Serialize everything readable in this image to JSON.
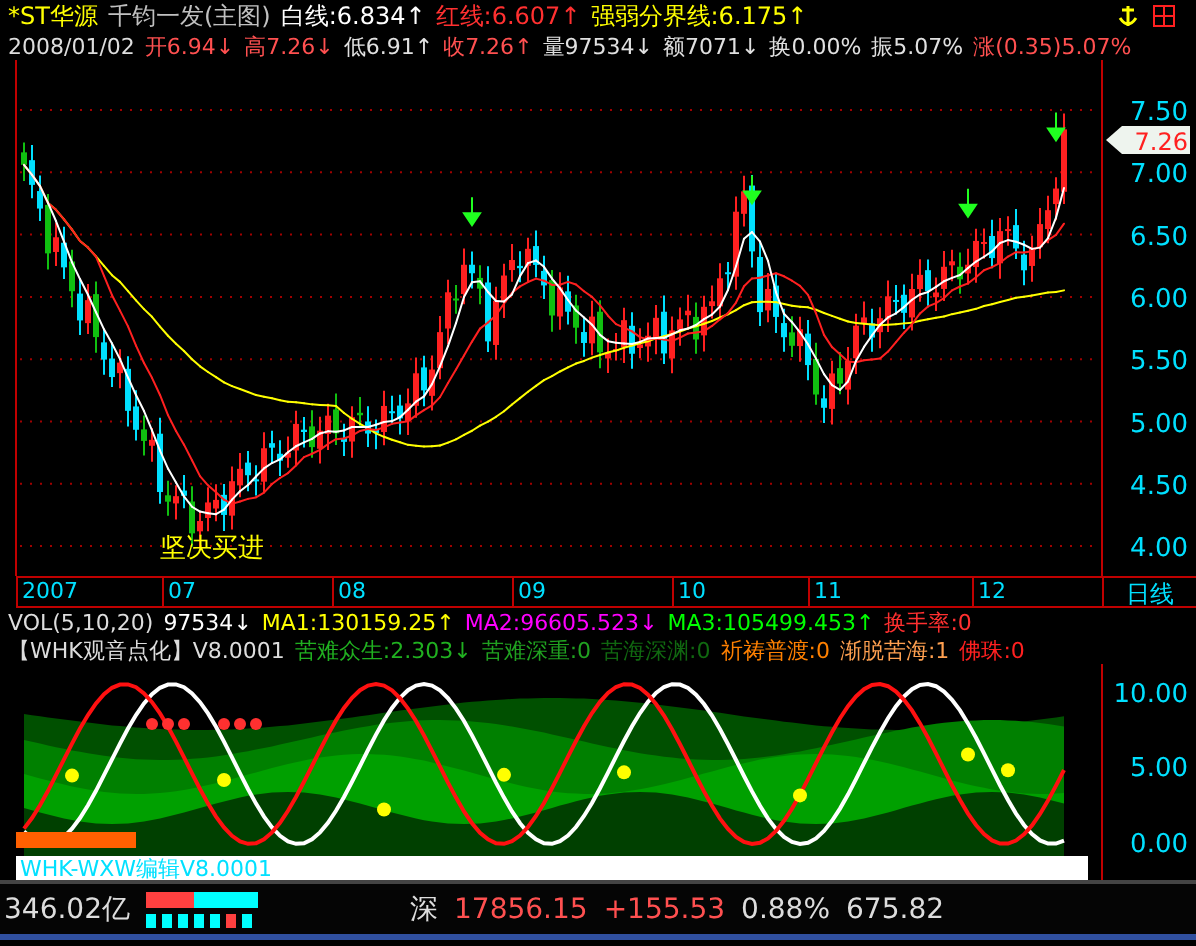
{
  "header": {
    "stock": "*ST华源",
    "formula": "千钧一发(主图)",
    "lines": [
      {
        "text": "白线:6.834",
        "arrow": "↑",
        "color": "#ffffff"
      },
      {
        "text": "红线:6.607",
        "arrow": "↑",
        "color": "#ff3030"
      },
      {
        "text": "强弱分界线:6.175",
        "arrow": "↑",
        "color": "#ffff00"
      }
    ]
  },
  "quote": {
    "date": "2008/01/02",
    "fields": [
      {
        "text": "开6.94",
        "arrow": "↓",
        "color": "#ff5050"
      },
      {
        "text": "高7.26",
        "arrow": "↓",
        "color": "#ff5050"
      },
      {
        "text": "低6.91",
        "arrow": "↑",
        "color": "#e0e0e0"
      },
      {
        "text": "收7.26",
        "arrow": "↑",
        "color": "#ff5050"
      },
      {
        "text": "量97534",
        "arrow": "↓",
        "color": "#e0e0e0"
      },
      {
        "text": "额7071",
        "arrow": "↓",
        "color": "#e0e0e0"
      },
      {
        "text": "换0.00%",
        "color": "#e0e0e0"
      },
      {
        "text": "振5.07%",
        "color": "#e0e0e0"
      },
      {
        "text": "涨(0.35)5.07%",
        "color": "#ff5050"
      }
    ]
  },
  "main_chart": {
    "y_labels": [
      "7.50",
      "7.00",
      "6.50",
      "6.00",
      "5.50",
      "5.00",
      "4.50",
      "4.00"
    ],
    "price_tag": "7.26",
    "signal_text": "坚决买进"
  },
  "date_axis": {
    "labels": [
      "2007",
      "07",
      "08",
      "09",
      "10",
      "11",
      "12"
    ],
    "period": "日线"
  },
  "volume": {
    "name": "VOL(5,10,20)",
    "items": [
      {
        "text": "97534",
        "arrow": "↓",
        "color": "#ffffff"
      },
      {
        "text": "MA1:130159.25",
        "arrow": "↑",
        "color": "#ffff00"
      },
      {
        "text": "MA2:96605.523",
        "arrow": "↓",
        "color": "#ff00ff"
      },
      {
        "text": "MA3:105499.453",
        "arrow": "↑",
        "color": "#00ff00"
      },
      {
        "text": "换手率:0",
        "color": "#ff3030"
      }
    ]
  },
  "indicator": {
    "name": "【WHK观音点化】V8.0001",
    "items": [
      {
        "text": "苦难众生:2.303",
        "arrow": "↓",
        "color": "#20b020"
      },
      {
        "text": "苦难深重:0",
        "color": "#20a020"
      },
      {
        "text": "苦海深渊:0",
        "color": "#106810"
      },
      {
        "text": "祈祷普渡:0",
        "color": "#ff8000"
      },
      {
        "text": "渐脱苦海:1",
        "color": "#ffa050"
      },
      {
        "text": "佛珠:0",
        "color": "#ff2020"
      }
    ]
  },
  "lower_chart": {
    "y_labels": [
      "10.00",
      "5.00",
      "0.00"
    ],
    "caption": "WHK-WXW编辑V8.0001"
  },
  "status_bar": {
    "turnover": "346.02亿",
    "market": "深",
    "index": "17856.15",
    "change": "+155.53",
    "percent": "0.88%",
    "amount": "675.82"
  }
}
